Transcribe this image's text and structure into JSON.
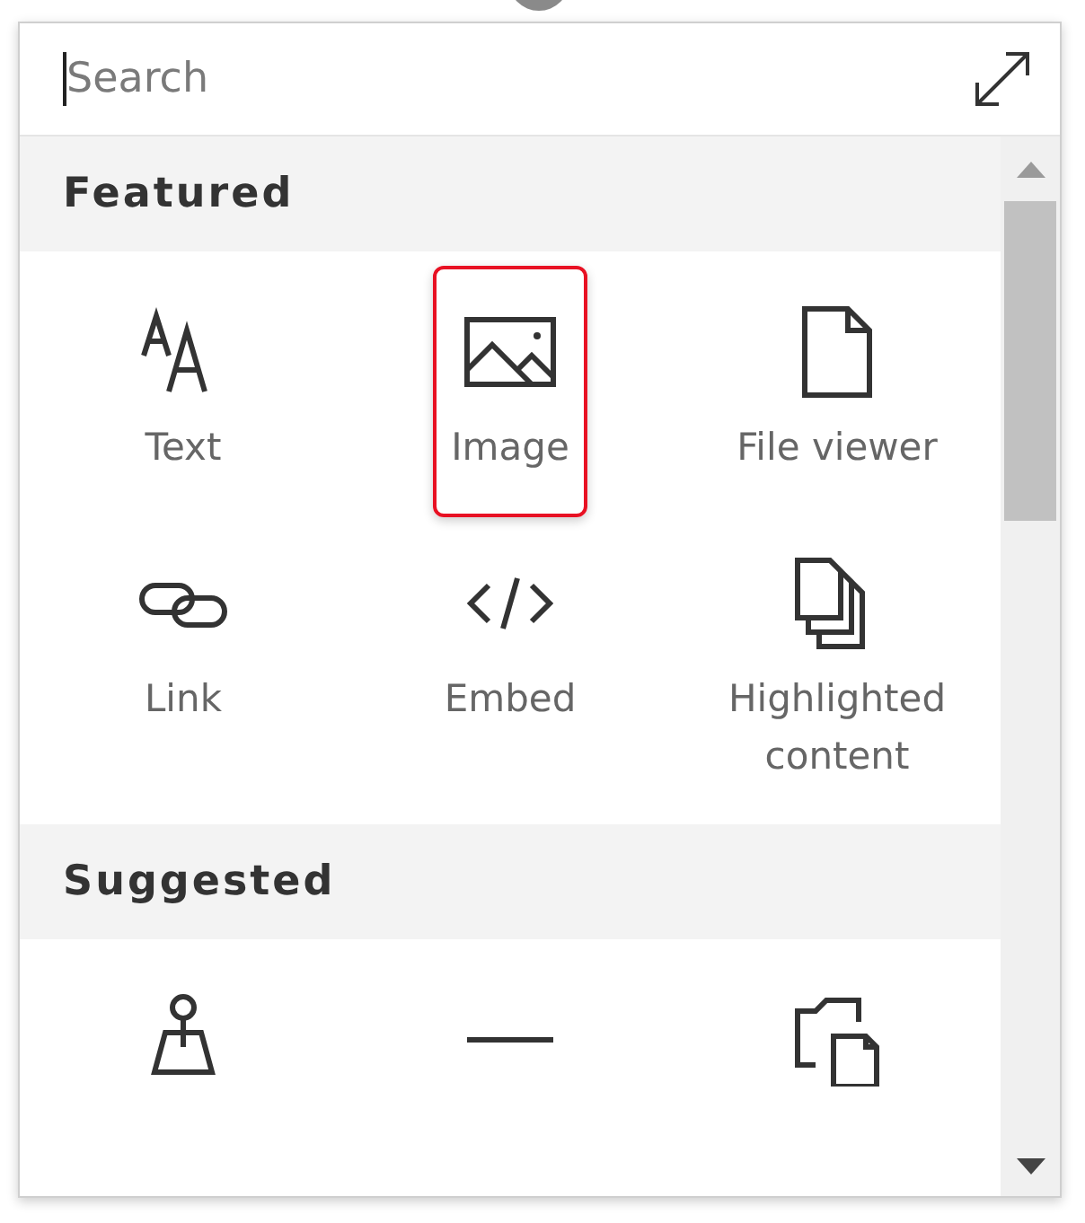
{
  "search": {
    "placeholder": "Search"
  },
  "sections": [
    {
      "title": "Featured",
      "items": [
        {
          "kind": "text",
          "label": "Text",
          "highlighted": false
        },
        {
          "kind": "image",
          "label": "Image",
          "highlighted": true
        },
        {
          "kind": "file",
          "label": "File viewer",
          "highlighted": false
        },
        {
          "kind": "link",
          "label": "Link",
          "highlighted": false
        },
        {
          "kind": "embed",
          "label": "Embed",
          "highlighted": false
        },
        {
          "kind": "pages",
          "label": "Highlighted content",
          "highlighted": false
        }
      ]
    },
    {
      "title": "Suggested",
      "items": [
        {
          "kind": "map",
          "highlighted": false
        },
        {
          "kind": "divider",
          "highlighted": false
        },
        {
          "kind": "folder",
          "highlighted": false
        }
      ]
    }
  ]
}
